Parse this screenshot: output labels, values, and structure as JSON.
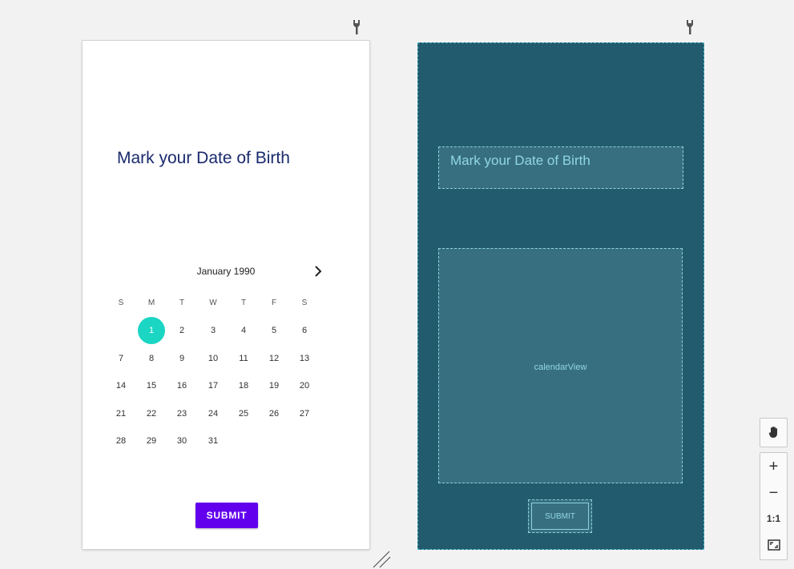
{
  "design": {
    "title": "Mark your Date of Birth",
    "month_label": "January 1990",
    "weekdays": [
      "S",
      "M",
      "T",
      "W",
      "T",
      "F",
      "S"
    ],
    "days": [
      "1",
      "2",
      "3",
      "4",
      "5",
      "6",
      "7",
      "8",
      "9",
      "10",
      "11",
      "12",
      "13",
      "14",
      "15",
      "16",
      "17",
      "18",
      "19",
      "20",
      "21",
      "22",
      "23",
      "24",
      "25",
      "26",
      "27",
      "28",
      "29",
      "30",
      "31"
    ],
    "selected_day": "1",
    "submit_label": "SUBMIT"
  },
  "blueprint": {
    "title": "Mark your Date of Birth",
    "calendar_label": "calendarView",
    "submit_label": "SUBMIT"
  },
  "zoom_controls": {
    "actual_size_label": "1:1"
  },
  "colors": {
    "canvas_bg": "#f2f2f2",
    "title_color": "#1a2a6c",
    "selected_day": "#1ad6c3",
    "button_purple": "#6200ee",
    "blueprint_bg": "#235b6e",
    "blueprint_accent": "#8fd6e4"
  }
}
